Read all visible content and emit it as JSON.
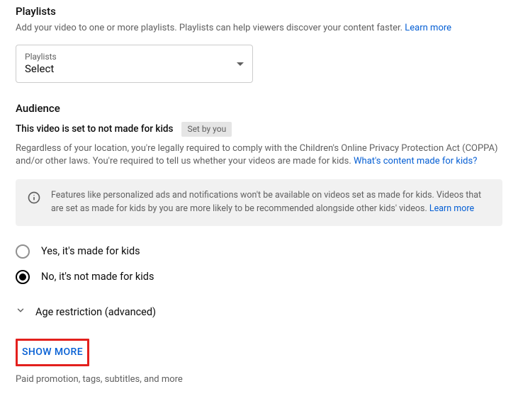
{
  "playlists": {
    "title": "Playlists",
    "description": "Add your video to one or more playlists. Playlists can help viewers discover your content faster. ",
    "learn_more": "Learn more",
    "field_label": "Playlists",
    "field_value": "Select"
  },
  "audience": {
    "title": "Audience",
    "status_text": "This video is set to not made for kids",
    "badge": "Set by you",
    "legal_text": "Regardless of your location, you're legally required to comply with the Children's Online Privacy Protection Act (COPPA) and/or other laws. You're required to tell us whether your videos are made for kids. ",
    "legal_link": "What's content made for kids?",
    "info_text": "Features like personalized ads and notifications won't be available on videos set as made for kids. Videos that are set as made for kids by you are more likely to be recommended alongside other kids' videos. ",
    "info_link": "Learn more",
    "option_yes": "Yes, it's made for kids",
    "option_no": "No, it's not made for kids",
    "selected": "no",
    "expander_label": "Age restriction (advanced)"
  },
  "show_more": {
    "button": "SHOW MORE",
    "subtitle": "Paid promotion, tags, subtitles, and more"
  }
}
